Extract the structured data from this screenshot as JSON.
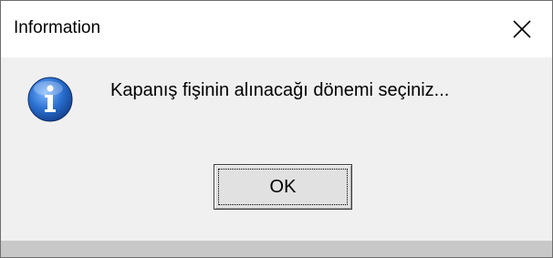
{
  "dialog": {
    "title": "Information",
    "message": "Kapanış fişinin alınacağı dönemi seçiniz...",
    "icon": "information-icon",
    "buttons": {
      "ok_label": "OK"
    },
    "close_icon": "close-icon"
  },
  "colors": {
    "titlebar": "#ffffff",
    "body": "#f0f0f0",
    "button": "#e1e1e1",
    "info_icon": "#1f5fb8"
  }
}
